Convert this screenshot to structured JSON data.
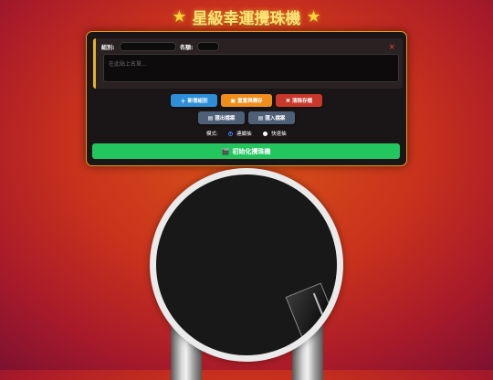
{
  "app_title": "星級幸運攪珠機",
  "title_icon": "star-icon",
  "group": {
    "group_label": "組別:",
    "group_value": "",
    "name_label": "名額:",
    "name_value": "",
    "close_label": "×",
    "textarea_placeholder": "在此貼上名單..."
  },
  "toolbar_row1": [
    {
      "label": "新增組別",
      "icon": "plus-icon",
      "color": "#2e8fd8"
    },
    {
      "label": "重置與轉存",
      "icon": "save-icon",
      "color": "#ef8e1b"
    },
    {
      "label": "清除存檔",
      "icon": "trash-icon",
      "color": "#c8392c"
    }
  ],
  "toolbar_row2": [
    {
      "label": "匯出檔案",
      "icon": "export-icon",
      "color": "#4e6078"
    },
    {
      "label": "匯入檔案",
      "icon": "import-icon",
      "color": "#4e6078"
    }
  ],
  "mode": {
    "label": "模式:",
    "options": [
      {
        "label": "連續抽",
        "selected": true
      },
      {
        "label": "快速抽",
        "selected": false
      }
    ]
  },
  "init_button": {
    "label": "初始化攪珠機",
    "icon": "clapper-icon"
  }
}
